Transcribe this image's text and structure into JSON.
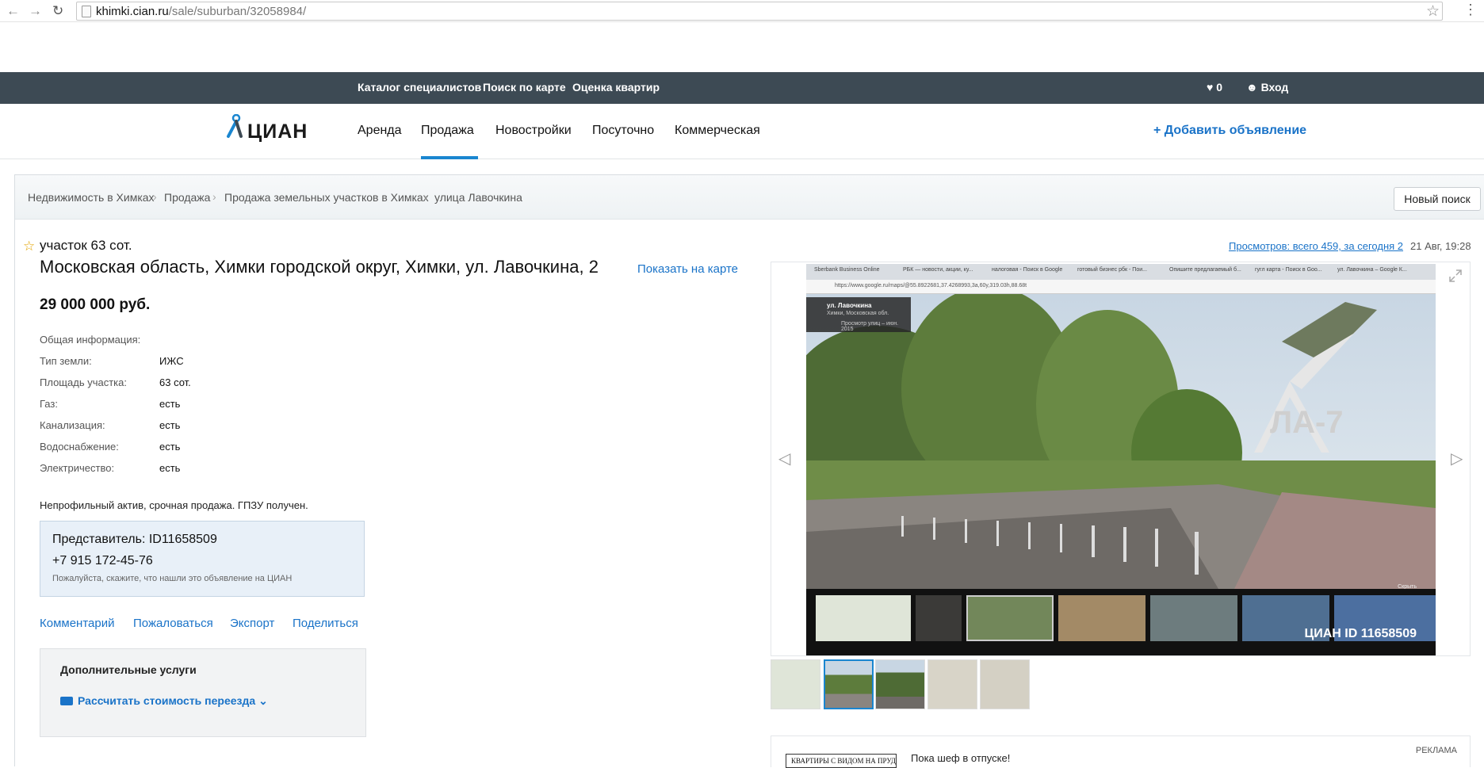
{
  "browser": {
    "url_host": "khimki.cian.ru",
    "url_path": "/sale/suburban/32058984/"
  },
  "topbar": {
    "links": [
      "Каталог специалистов",
      "Поиск по карте",
      "Оценка квартир"
    ],
    "favorites_count": "0",
    "login": "Вход"
  },
  "header": {
    "logo": "ЦИАН",
    "nav": [
      "Аренда",
      "Продажа",
      "Новостройки",
      "Посуточно",
      "Коммерческая"
    ],
    "active_nav": "Продажа",
    "add_listing": "Добавить объявление"
  },
  "breadcrumbs": [
    "Недвижимость в Химках",
    "Продажа",
    "Продажа земельных участков в Химках",
    "улица Лавочкина"
  ],
  "new_search": "Новый поиск",
  "listing": {
    "lot_size": "участок 63 сот.",
    "address": "Московская область, Химки городской округ, Химки, ул. Лавочкина, 2",
    "show_on_map": "Показать на карте",
    "price": "29 000 000 руб.",
    "views": "Просмотров: всего 459, за сегодня 2",
    "date": "21 Авг, 19:28",
    "info_title": "Общая информация:",
    "info": [
      {
        "label": "Тип земли:",
        "value": "ИЖС"
      },
      {
        "label": "Площадь участка:",
        "value": "63 сот."
      },
      {
        "label": "Газ:",
        "value": "есть"
      },
      {
        "label": "Канализация:",
        "value": "есть"
      },
      {
        "label": "Водоснабжение:",
        "value": "есть"
      },
      {
        "label": "Электричество:",
        "value": "есть"
      }
    ],
    "description": "Непрофильный актив, срочная продажа. ГПЗУ получен."
  },
  "agent": {
    "name": "Представитель: ID11658509",
    "phone": "+7 915 172-45-76",
    "hint": "Пожалуйста, скажите, что нашли это объявление на ЦИАН"
  },
  "actions": [
    "Комментарий",
    "Пожаловаться",
    "Экспорт",
    "Поделиться"
  ],
  "services": {
    "title": "Дополнительные услуги",
    "calc": "Рассчитать стоимость переезда"
  },
  "photo": {
    "tabs": [
      "Sberbank Business Online",
      "РБК — новости, акции, ку...",
      "налоговая - Поиск в Google",
      "готовый бизнес рбк - Пои...",
      "Опишите предлагаемый б...",
      "гугл карта - Поиск в Goo...",
      "ул. Лавочкина – Google К..."
    ],
    "addr_url": "https://www.google.ru/maps/@55.8922681,37.4268993,3a,60y,319.03h,88.68t",
    "street": "ул. Лавочкина",
    "city": "Химки, Московская обл.",
    "streetview_date": "Просмотр улиц – июн. 2015",
    "hide": "Скрыть",
    "watermark": "ЦИАН ID 11658509",
    "monument_text": "ЛА-7"
  },
  "ad": {
    "label": "РЕКЛАМА",
    "banner_text": "КВАРТИРЫ С ВИДОМ НА ПРУД",
    "text": "Пока шеф в отпуске!"
  },
  "colors": {
    "topbar": "#3d4a54",
    "accent": "#1a73c8",
    "active_underline": "#1a86d0"
  }
}
